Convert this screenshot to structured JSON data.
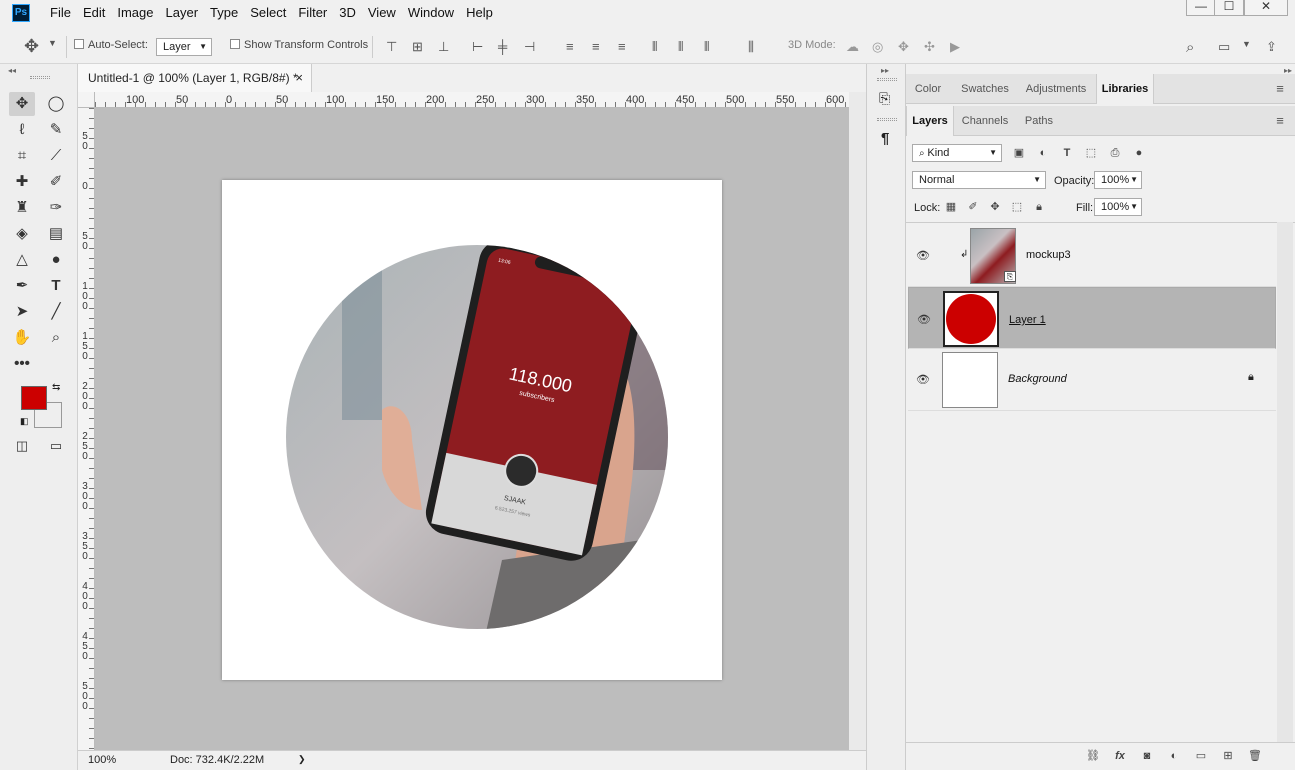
{
  "app": {
    "logo": "Ps"
  },
  "menu": [
    "File",
    "Edit",
    "Image",
    "Layer",
    "Type",
    "Select",
    "Filter",
    "3D",
    "View",
    "Window",
    "Help"
  ],
  "window_controls": {
    "minimize": "—",
    "maximize": "☐",
    "close": "✕"
  },
  "options": {
    "auto_select_label": "Auto-Select:",
    "auto_select_value": "Layer",
    "show_transform_label": "Show Transform Controls",
    "mode3d_label": "3D Mode:"
  },
  "document": {
    "tab_title": "Untitled-1 @ 100% (Layer 1, RGB/8#) *",
    "close_glyph": "×"
  },
  "ruler_top": [
    "100",
    "50",
    "0",
    "50",
    "100",
    "150",
    "200",
    "250",
    "300",
    "350",
    "400",
    "450",
    "500",
    "550",
    "600"
  ],
  "ruler_left": [
    "5\n0",
    "0",
    "5\n0",
    "1\n0\n0",
    "1\n5\n0",
    "2\n0\n0",
    "2\n5\n0",
    "3\n0\n0",
    "3\n5\n0",
    "4\n0\n0",
    "4\n5\n0",
    "5\n0\n0"
  ],
  "canvas_content": {
    "phone_count": "118.000",
    "phone_subtitle": "subscribers",
    "phone_name": "SJAAK",
    "phone_views": "6.523.257 views",
    "phone_time": "13:06"
  },
  "status": {
    "zoom": "100%",
    "doc": "Doc: 732.4K/2.22M",
    "arrow": "❯"
  },
  "panel_top_tabs": [
    "Color",
    "Swatches",
    "Adjustments",
    "Libraries"
  ],
  "panel_top_active": "Libraries",
  "layers_tabs": [
    "Layers",
    "Channels",
    "Paths"
  ],
  "layers_active": "Layers",
  "layers_controls": {
    "kind": "Kind",
    "blend": "Normal",
    "opacity_label": "Opacity:",
    "opacity_value": "100%",
    "lock_label": "Lock:",
    "fill_label": "Fill:",
    "fill_value": "100%"
  },
  "layers": [
    {
      "name": "mockup3",
      "selected": false
    },
    {
      "name": "Layer 1",
      "selected": true
    },
    {
      "name": "Background",
      "selected": false
    }
  ],
  "colors": {
    "foreground": "#cc0000",
    "background": "#ffffff",
    "accent": "#001e36"
  }
}
